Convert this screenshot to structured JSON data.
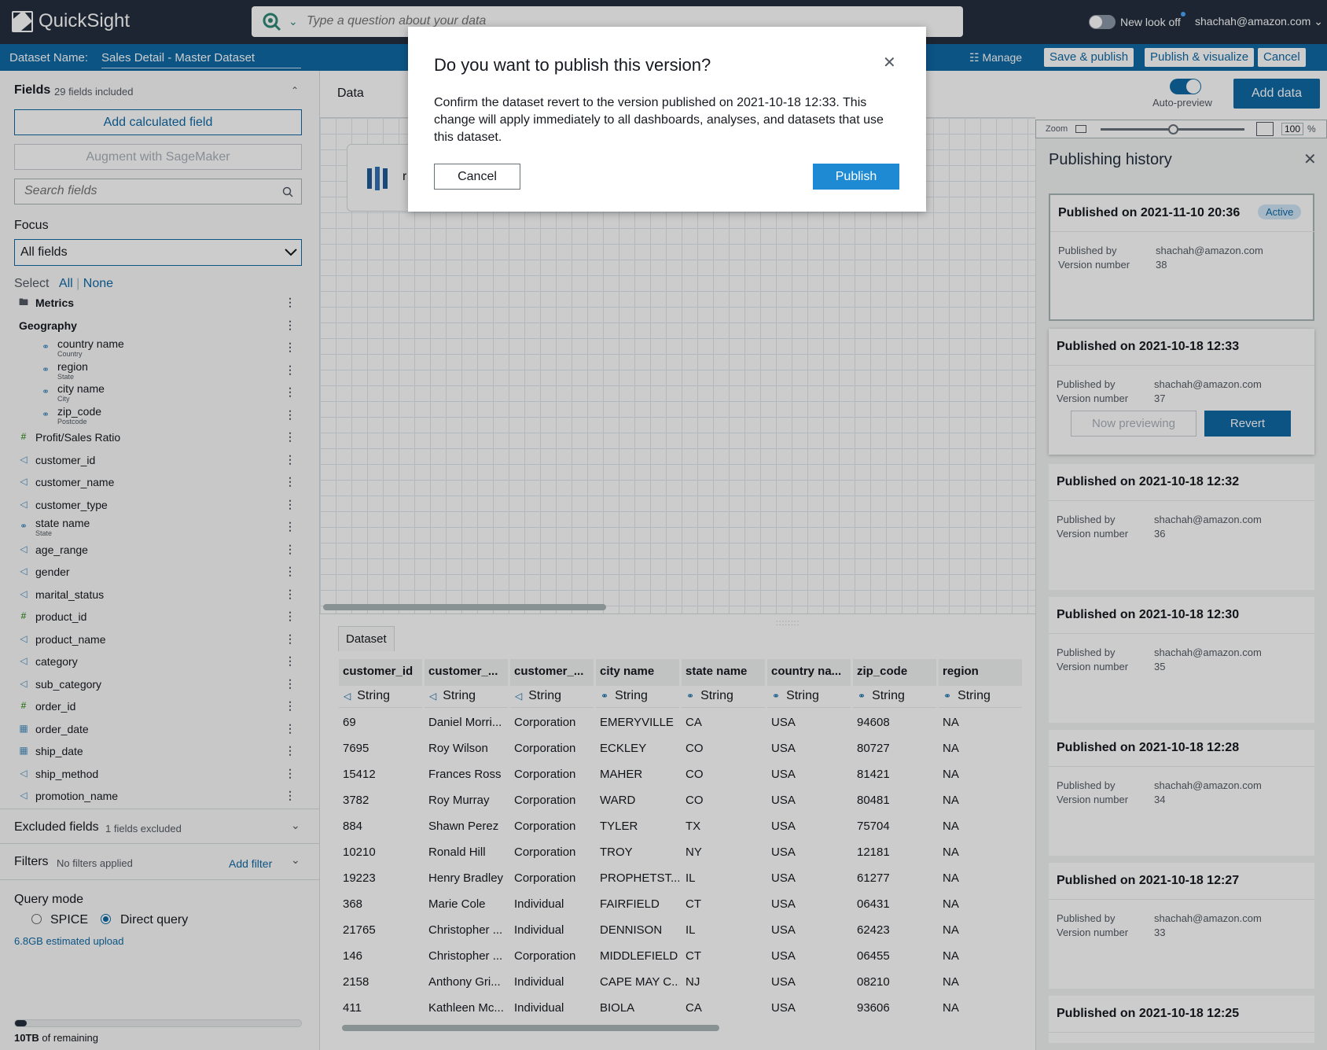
{
  "app": {
    "name": "QuickSight",
    "question_placeholder": "Type a question about your data",
    "new_look": "New look off",
    "user": "shachah@amazon.com"
  },
  "dataset_bar": {
    "label": "Dataset Name:",
    "name": "Sales Detail - Master Dataset",
    "manage": "Manage",
    "save_publish": "Save & publish",
    "publish_visualize": "Publish & visualize",
    "cancel": "Cancel"
  },
  "fields": {
    "title": "Fields",
    "count": "29 fields included",
    "add_calc": "Add calculated field",
    "augment": "Augment with SageMaker",
    "search_placeholder": "Search fields",
    "focus_label": "Focus",
    "focus_value": "All fields",
    "select_label": "Select",
    "select_all": "All",
    "select_none": "None",
    "items": [
      {
        "name": "Metrics",
        "sub": "",
        "icon": "folder-icon"
      },
      {
        "name": "Geography",
        "sub": "",
        "icon": ""
      },
      {
        "name": "country name",
        "sub": "Country",
        "icon": "geo-icon"
      },
      {
        "name": "region",
        "sub": "State",
        "icon": "geo-icon"
      },
      {
        "name": "city name",
        "sub": "City",
        "icon": "geo-icon"
      },
      {
        "name": "zip_code",
        "sub": "Postcode",
        "icon": "geo-icon"
      },
      {
        "name": "Profit/Sales Ratio",
        "sub": "",
        "icon": "number-icon"
      },
      {
        "name": "customer_id",
        "sub": "",
        "icon": "string-icon"
      },
      {
        "name": "customer_name",
        "sub": "",
        "icon": "string-icon"
      },
      {
        "name": "customer_type",
        "sub": "",
        "icon": "string-icon"
      },
      {
        "name": "state name",
        "sub": "State",
        "icon": "geo-icon"
      },
      {
        "name": "age_range",
        "sub": "",
        "icon": "string-icon"
      },
      {
        "name": "gender",
        "sub": "",
        "icon": "string-icon"
      },
      {
        "name": "marital_status",
        "sub": "",
        "icon": "string-icon"
      },
      {
        "name": "product_id",
        "sub": "",
        "icon": "number-icon"
      },
      {
        "name": "product_name",
        "sub": "",
        "icon": "string-icon"
      },
      {
        "name": "category",
        "sub": "",
        "icon": "string-icon"
      },
      {
        "name": "sub_category",
        "sub": "",
        "icon": "string-icon"
      },
      {
        "name": "order_id",
        "sub": "",
        "icon": "number-icon"
      },
      {
        "name": "order_date",
        "sub": "",
        "icon": "date-icon"
      },
      {
        "name": "ship_date",
        "sub": "",
        "icon": "date-icon"
      },
      {
        "name": "ship_method",
        "sub": "",
        "icon": "string-icon"
      },
      {
        "name": "promotion_name",
        "sub": "",
        "icon": "string-icon"
      }
    ]
  },
  "excluded": {
    "title": "Excluded fields",
    "count": "1 fields excluded"
  },
  "filters": {
    "title": "Filters",
    "status": "No filters applied",
    "add": "Add filter"
  },
  "query_mode": {
    "title": "Query mode",
    "spice": "SPICE",
    "direct": "Direct query",
    "estimate": "6.8GB estimated upload",
    "remaining_bold": "10TB",
    "remaining_rest": " of remaining",
    "usage_fraction": 0.04
  },
  "data_panel": {
    "title": "Data",
    "add_data": "Add data",
    "auto_preview": "Auto-preview",
    "zoom_label": "Zoom",
    "zoom_value": "100",
    "zoom_unit": "%",
    "node_letter": "r"
  },
  "dataset_tab": "Dataset",
  "table": {
    "columns": [
      {
        "header": "customer_id",
        "type": "String",
        "icon": "string-icon"
      },
      {
        "header": "customer_...",
        "type": "String",
        "icon": "string-icon"
      },
      {
        "header": "customer_...",
        "type": "String",
        "icon": "string-icon"
      },
      {
        "header": "city name",
        "type": "String",
        "icon": "geo-icon"
      },
      {
        "header": "state name",
        "type": "String",
        "icon": "geo-icon"
      },
      {
        "header": "country na...",
        "type": "String",
        "icon": "geo-icon"
      },
      {
        "header": "zip_code",
        "type": "String",
        "icon": "geo-icon"
      },
      {
        "header": "region",
        "type": "String",
        "icon": "geo-icon"
      }
    ],
    "rows": [
      [
        "69",
        "Daniel Morri...",
        "Corporation",
        "EMERYVILLE",
        "CA",
        "USA",
        "94608",
        "NA"
      ],
      [
        "7695",
        "Roy Wilson",
        "Corporation",
        "ECKLEY",
        "CO",
        "USA",
        "80727",
        "NA"
      ],
      [
        "15412",
        "Frances Ross",
        "Corporation",
        "MAHER",
        "CO",
        "USA",
        "81421",
        "NA"
      ],
      [
        "3782",
        "Roy Murray",
        "Corporation",
        "WARD",
        "CO",
        "USA",
        "80481",
        "NA"
      ],
      [
        "884",
        "Shawn Perez",
        "Corporation",
        "TYLER",
        "TX",
        "USA",
        "75704",
        "NA"
      ],
      [
        "10210",
        "Ronald Hill",
        "Corporation",
        "TROY",
        "NY",
        "USA",
        "12181",
        "NA"
      ],
      [
        "19223",
        "Henry Bradley",
        "Corporation",
        "PROPHETST...",
        "IL",
        "USA",
        "61277",
        "NA"
      ],
      [
        "368",
        "Marie Cole",
        "Individual",
        "FAIRFIELD",
        "CT",
        "USA",
        "06431",
        "NA"
      ],
      [
        "21765",
        "Christopher ...",
        "Individual",
        "DENNISON",
        "IL",
        "USA",
        "62423",
        "NA"
      ],
      [
        "146",
        "Christopher ...",
        "Corporation",
        "MIDDLEFIELD",
        "CT",
        "USA",
        "06455",
        "NA"
      ],
      [
        "2158",
        "Anthony Gri...",
        "Individual",
        "CAPE MAY C...",
        "NJ",
        "USA",
        "08210",
        "NA"
      ],
      [
        "411",
        "Kathleen Mc...",
        "Individual",
        "BIOLA",
        "CA",
        "USA",
        "93606",
        "NA"
      ]
    ]
  },
  "history": {
    "title": "Publishing history",
    "active_badge": "Active",
    "published_by_label": "Published by",
    "version_label": "Version number",
    "now_previewing": "Now previewing",
    "revert": "Revert",
    "entries": [
      {
        "title": "Published on 2021-11-10 20:36",
        "by": "shachah@amazon.com",
        "version": "38"
      },
      {
        "title": "Published on 2021-10-18 12:33",
        "by": "shachah@amazon.com",
        "version": "37"
      },
      {
        "title": "Published on 2021-10-18 12:32",
        "by": "shachah@amazon.com",
        "version": "36"
      },
      {
        "title": "Published on 2021-10-18 12:30",
        "by": "shachah@amazon.com",
        "version": "35"
      },
      {
        "title": "Published on 2021-10-18 12:28",
        "by": "shachah@amazon.com",
        "version": "34"
      },
      {
        "title": "Published on 2021-10-18 12:27",
        "by": "shachah@amazon.com",
        "version": "33"
      },
      {
        "title": "Published on 2021-10-18 12:25",
        "by": "",
        "version": ""
      }
    ]
  },
  "modal": {
    "title": "Do you want to publish this version?",
    "body": "Confirm the dataset revert to the version published on 2021-10-18 12:33. This change will apply immediately to all dashboards, analyses, and datasets that use this dataset.",
    "cancel": "Cancel",
    "publish": "Publish"
  }
}
